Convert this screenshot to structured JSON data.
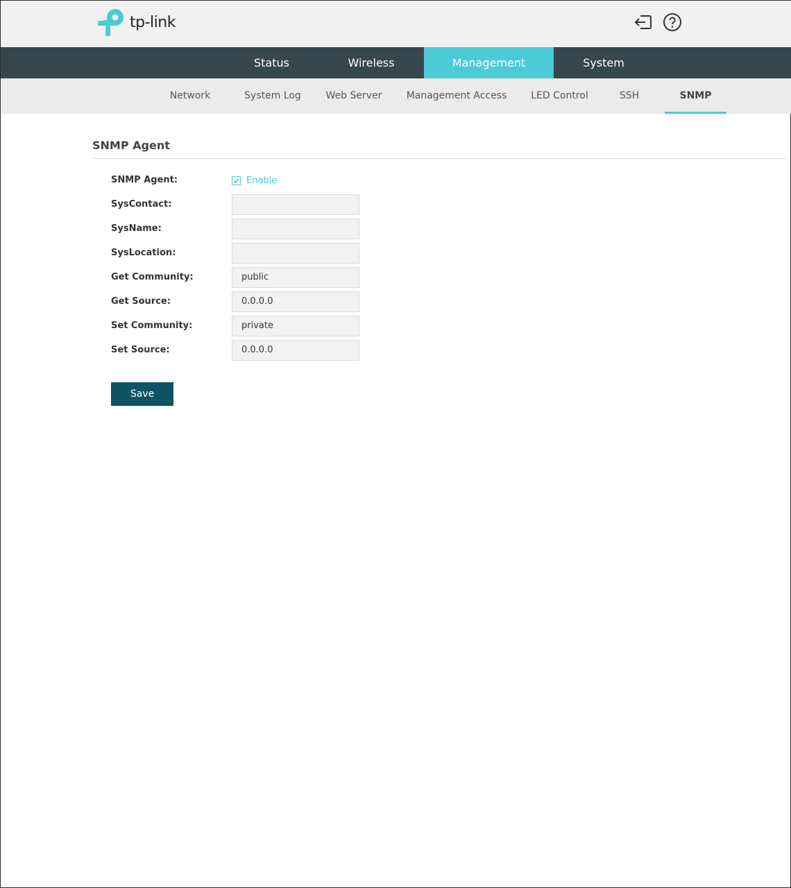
{
  "brand": {
    "name": "tp-link",
    "color": "#4acbd6"
  },
  "header": {
    "logout_icon": "logout-icon",
    "help_icon": "help-icon"
  },
  "main_nav": {
    "tabs": [
      {
        "label": "Status",
        "active": false
      },
      {
        "label": "Wireless",
        "active": false
      },
      {
        "label": "Management",
        "active": true
      },
      {
        "label": "System",
        "active": false
      }
    ]
  },
  "sub_nav": {
    "tabs": [
      {
        "label": "Network",
        "active": false
      },
      {
        "label": "System Log",
        "active": false
      },
      {
        "label": "Web Server",
        "active": false
      },
      {
        "label": "Management Access",
        "active": false
      },
      {
        "label": "LED Control",
        "active": false
      },
      {
        "label": "SSH",
        "active": false
      },
      {
        "label": "SNMP",
        "active": true
      }
    ]
  },
  "section": {
    "title": "SNMP Agent"
  },
  "form": {
    "snmp_agent": {
      "label": "SNMP Agent:",
      "checkbox_label": "Enable",
      "checked": true
    },
    "fields": [
      {
        "label": "SysContact:",
        "value": ""
      },
      {
        "label": "SysName:",
        "value": ""
      },
      {
        "label": "SysLocation:",
        "value": ""
      },
      {
        "label": "Get Community:",
        "value": "public"
      },
      {
        "label": "Get Source:",
        "value": "0.0.0.0"
      },
      {
        "label": "Set Community:",
        "value": "private"
      },
      {
        "label": "Set Source:",
        "value": "0.0.0.0"
      }
    ],
    "save_label": "Save"
  },
  "colors": {
    "accent": "#4acbd6",
    "nav_bg": "#37474f",
    "save_button": "#0f5465"
  }
}
